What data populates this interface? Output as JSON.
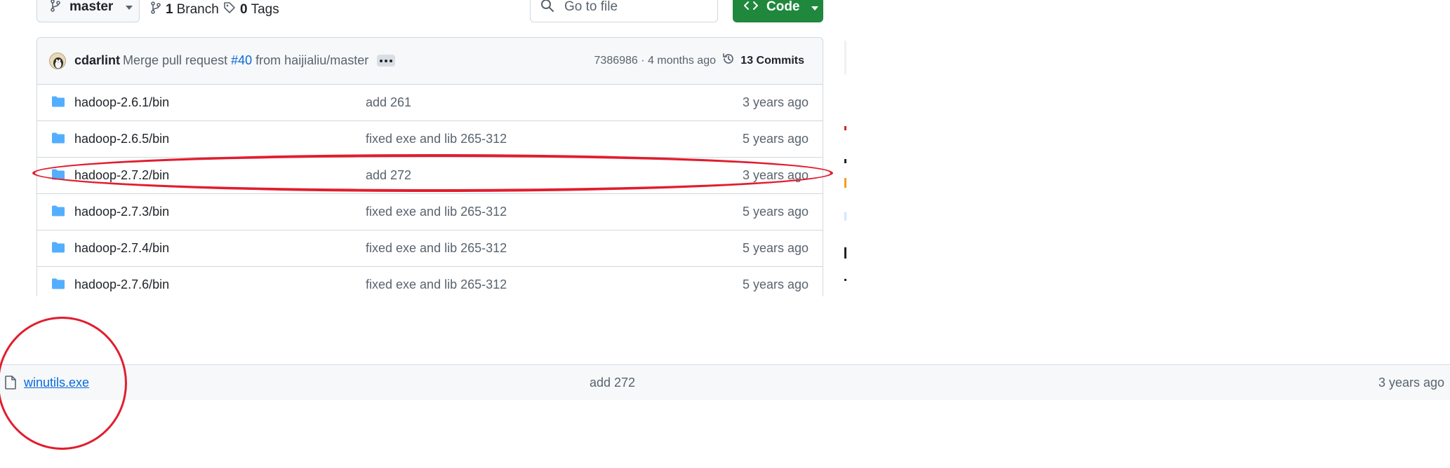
{
  "toolbar": {
    "branch_label": "master",
    "branches_count": "1",
    "branches_word": "Branch",
    "tags_count": "0",
    "tags_word": "Tags",
    "search_placeholder": "Go to file",
    "code_label": "Code"
  },
  "commit": {
    "author": "cdarlint",
    "message_prefix": "Merge pull request",
    "pr_number": "#40",
    "message_suffix": "from haijialiu/master",
    "hash_time": "7386986 · 4 months ago",
    "commits_label": "13 Commits"
  },
  "rows": [
    {
      "name": "hadoop-2.6.1/bin",
      "message": "add 261",
      "date": "3 years ago"
    },
    {
      "name": "hadoop-2.6.5/bin",
      "message": "fixed exe and lib 265-312",
      "date": "5 years ago"
    },
    {
      "name": "hadoop-2.7.2/bin",
      "message": "add 272",
      "date": "3 years ago"
    },
    {
      "name": "hadoop-2.7.3/bin",
      "message": "fixed exe and lib 265-312",
      "date": "5 years ago"
    },
    {
      "name": "hadoop-2.7.4/bin",
      "message": "fixed exe and lib 265-312",
      "date": "5 years ago"
    },
    {
      "name": "hadoop-2.7.6/bin",
      "message": "fixed exe and lib 265-312",
      "date": "5 years ago"
    }
  ],
  "file_row": {
    "name": "winutils.exe",
    "message": "add 272",
    "date": "3 years ago"
  },
  "colors": {
    "annotation_red": "#e11d2e",
    "folder_blue": "#54aeff",
    "link_blue": "#0969da",
    "code_green": "#1f883d"
  },
  "icons": {
    "branch": "git-branch-icon",
    "tag": "tag-icon",
    "search": "search-icon",
    "code": "code-icon",
    "history": "history-icon",
    "folder": "folder-icon",
    "file": "file-icon"
  }
}
